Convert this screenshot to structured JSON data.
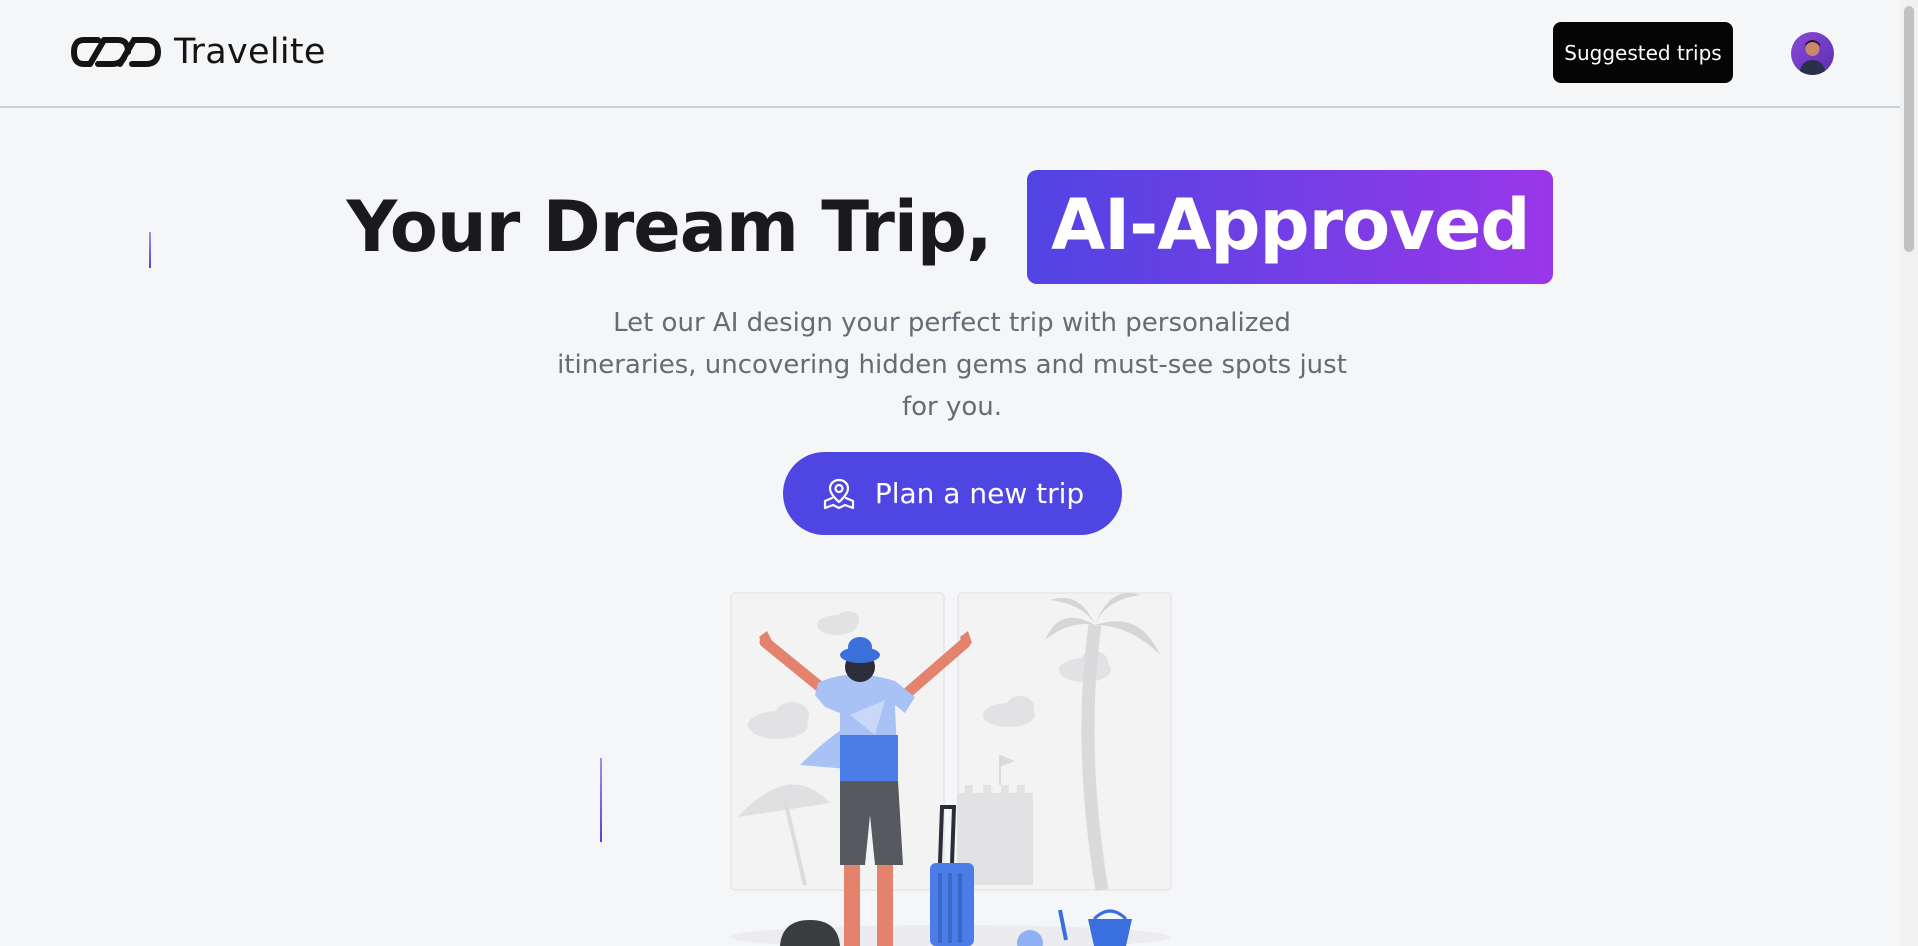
{
  "brand": {
    "name": "Travelite"
  },
  "header": {
    "suggested_label": "Suggested trips"
  },
  "hero": {
    "title_plain": "Your Dream Trip,",
    "title_highlight": "AI-Approved",
    "subtitle": "Let our AI design your perfect trip with personalized itineraries, uncovering hidden gems and must-see spots just for you.",
    "cta_label": "Plan a new trip"
  },
  "colors": {
    "accent": "#4e45e2",
    "highlight_start": "#5144e3",
    "highlight_end": "#9a37e8",
    "header_button": "#050505",
    "background": "#f5f6f8"
  },
  "icons": {
    "logo": "infinity-links-logo-icon",
    "cta": "map-pin-icon",
    "avatar": "user-avatar"
  }
}
